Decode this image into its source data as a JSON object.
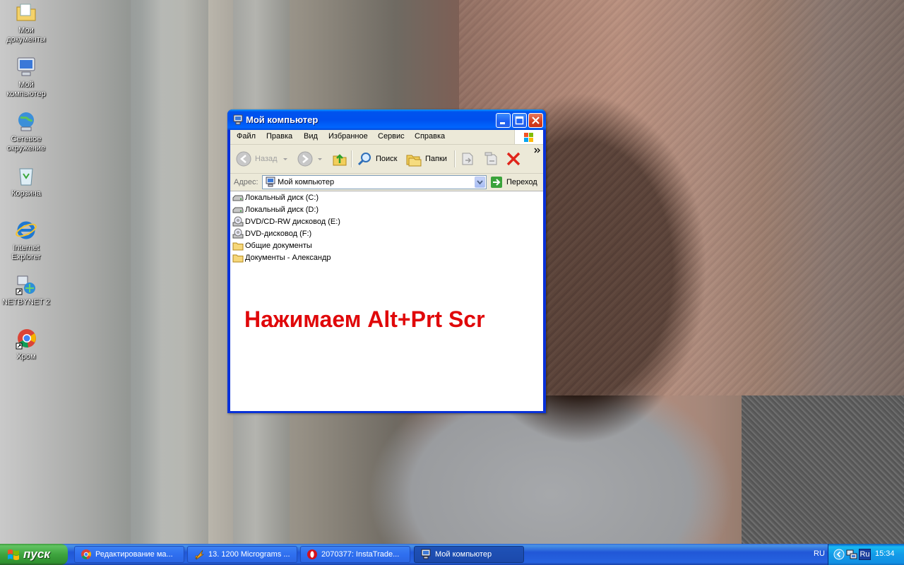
{
  "desktop": {
    "icons": [
      {
        "label": "Мои документы",
        "icon": "my-documents-icon"
      },
      {
        "label": "Мой компьютер",
        "icon": "my-computer-icon"
      },
      {
        "label": "Сетевое окружение",
        "icon": "network-places-icon"
      },
      {
        "label": "Корзина",
        "icon": "recycle-bin-icon"
      },
      {
        "label": "Internet Explorer",
        "icon": "internet-explorer-icon"
      },
      {
        "label": "NETBYNET 2",
        "icon": "netbynet-icon"
      },
      {
        "label": "Хром",
        "icon": "chrome-icon"
      }
    ]
  },
  "window": {
    "title": "Мой компьютер",
    "menu": [
      "Файл",
      "Правка",
      "Вид",
      "Избранное",
      "Сервис",
      "Справка"
    ],
    "toolbar": {
      "back_label": "Назад",
      "search_label": "Поиск",
      "folders_label": "Папки"
    },
    "address": {
      "label": "Адрес:",
      "value": "Мой компьютер",
      "go_label": "Переход"
    },
    "items": [
      {
        "label": "Локальный диск (C:)",
        "icon": "hard-drive-icon"
      },
      {
        "label": "Локальный диск (D:)",
        "icon": "hard-drive-icon"
      },
      {
        "label": "DVD/CD-RW дисковод (E:)",
        "icon": "dvd-drive-icon"
      },
      {
        "label": "DVD-дисковод (F:)",
        "icon": "dvd-drive-icon"
      },
      {
        "label": "Общие документы",
        "icon": "folder-icon"
      },
      {
        "label": "Документы - Александр",
        "icon": "folder-icon"
      }
    ],
    "overlay_text": "Нажимаем Alt+Prt Scr"
  },
  "taskbar": {
    "start_label": "пуск",
    "tasks": [
      {
        "label": "Редактирование ма...",
        "icon": "chrome-icon",
        "active": false
      },
      {
        "label": "13. 1200 Micrograms ...",
        "icon": "winamp-icon",
        "active": false
      },
      {
        "label": "2070377: InstaTrade...",
        "icon": "opera-icon",
        "active": false
      },
      {
        "label": "Мой компьютер",
        "icon": "my-computer-icon",
        "active": true
      }
    ],
    "language": "RU",
    "tray_lang": "Ru",
    "clock": "15:34"
  },
  "colors": {
    "titlebar": "#0053ee",
    "overlay_text": "#e0080a",
    "start_button": "#3ea43e",
    "taskbar": "#2157d7"
  }
}
